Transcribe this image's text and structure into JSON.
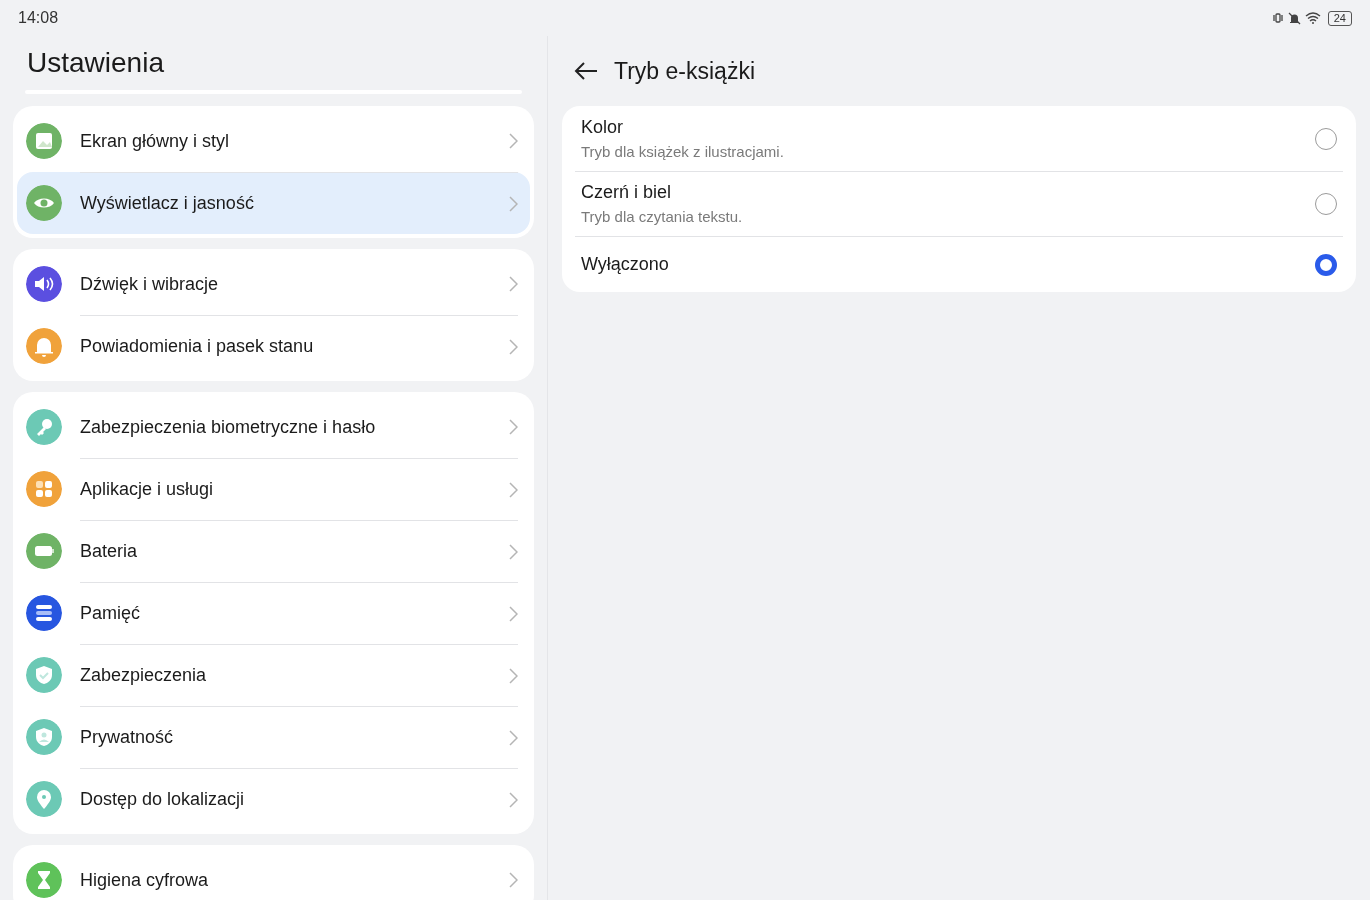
{
  "status_bar": {
    "time": "14:08",
    "battery": "24"
  },
  "sidebar": {
    "title": "Ustawienia",
    "groups": [
      {
        "items": [
          {
            "label": "Ekran główny i styl",
            "color": "#6fb366",
            "selected": false
          },
          {
            "label": "Wyświetlacz i jasność",
            "color": "#6fb366",
            "selected": true
          }
        ]
      },
      {
        "items": [
          {
            "label": "Dźwięk i wibracje",
            "color": "#5b4fe0",
            "selected": false
          },
          {
            "label": "Powiadomienia i pasek stanu",
            "color": "#f0a23b",
            "selected": false
          }
        ]
      },
      {
        "items": [
          {
            "label": "Zabezpieczenia biometryczne i hasło",
            "color": "#6cc9b5",
            "selected": false
          },
          {
            "label": "Aplikacje i usługi",
            "color": "#f0a23b",
            "selected": false
          },
          {
            "label": "Bateria",
            "color": "#6fb366",
            "selected": false
          },
          {
            "label": "Pamięć",
            "color": "#2756e0",
            "selected": false
          },
          {
            "label": "Zabezpieczenia",
            "color": "#6cc9b5",
            "selected": false
          },
          {
            "label": "Prywatność",
            "color": "#6cc9b5",
            "selected": false
          },
          {
            "label": "Dostęp do lokalizacji",
            "color": "#6cc9b5",
            "selected": false
          }
        ]
      },
      {
        "items": [
          {
            "label": "Higiena cyfrowa",
            "color": "#5fc25a",
            "selected": false
          }
        ]
      }
    ]
  },
  "detail": {
    "title": "Tryb e-książki",
    "options": [
      {
        "label": "Kolor",
        "description": "Tryb dla książek z ilustracjami.",
        "selected": false
      },
      {
        "label": "Czerń i biel",
        "description": "Tryb dla czytania tekstu.",
        "selected": false
      },
      {
        "label": "Wyłączono",
        "selected": true
      }
    ]
  }
}
